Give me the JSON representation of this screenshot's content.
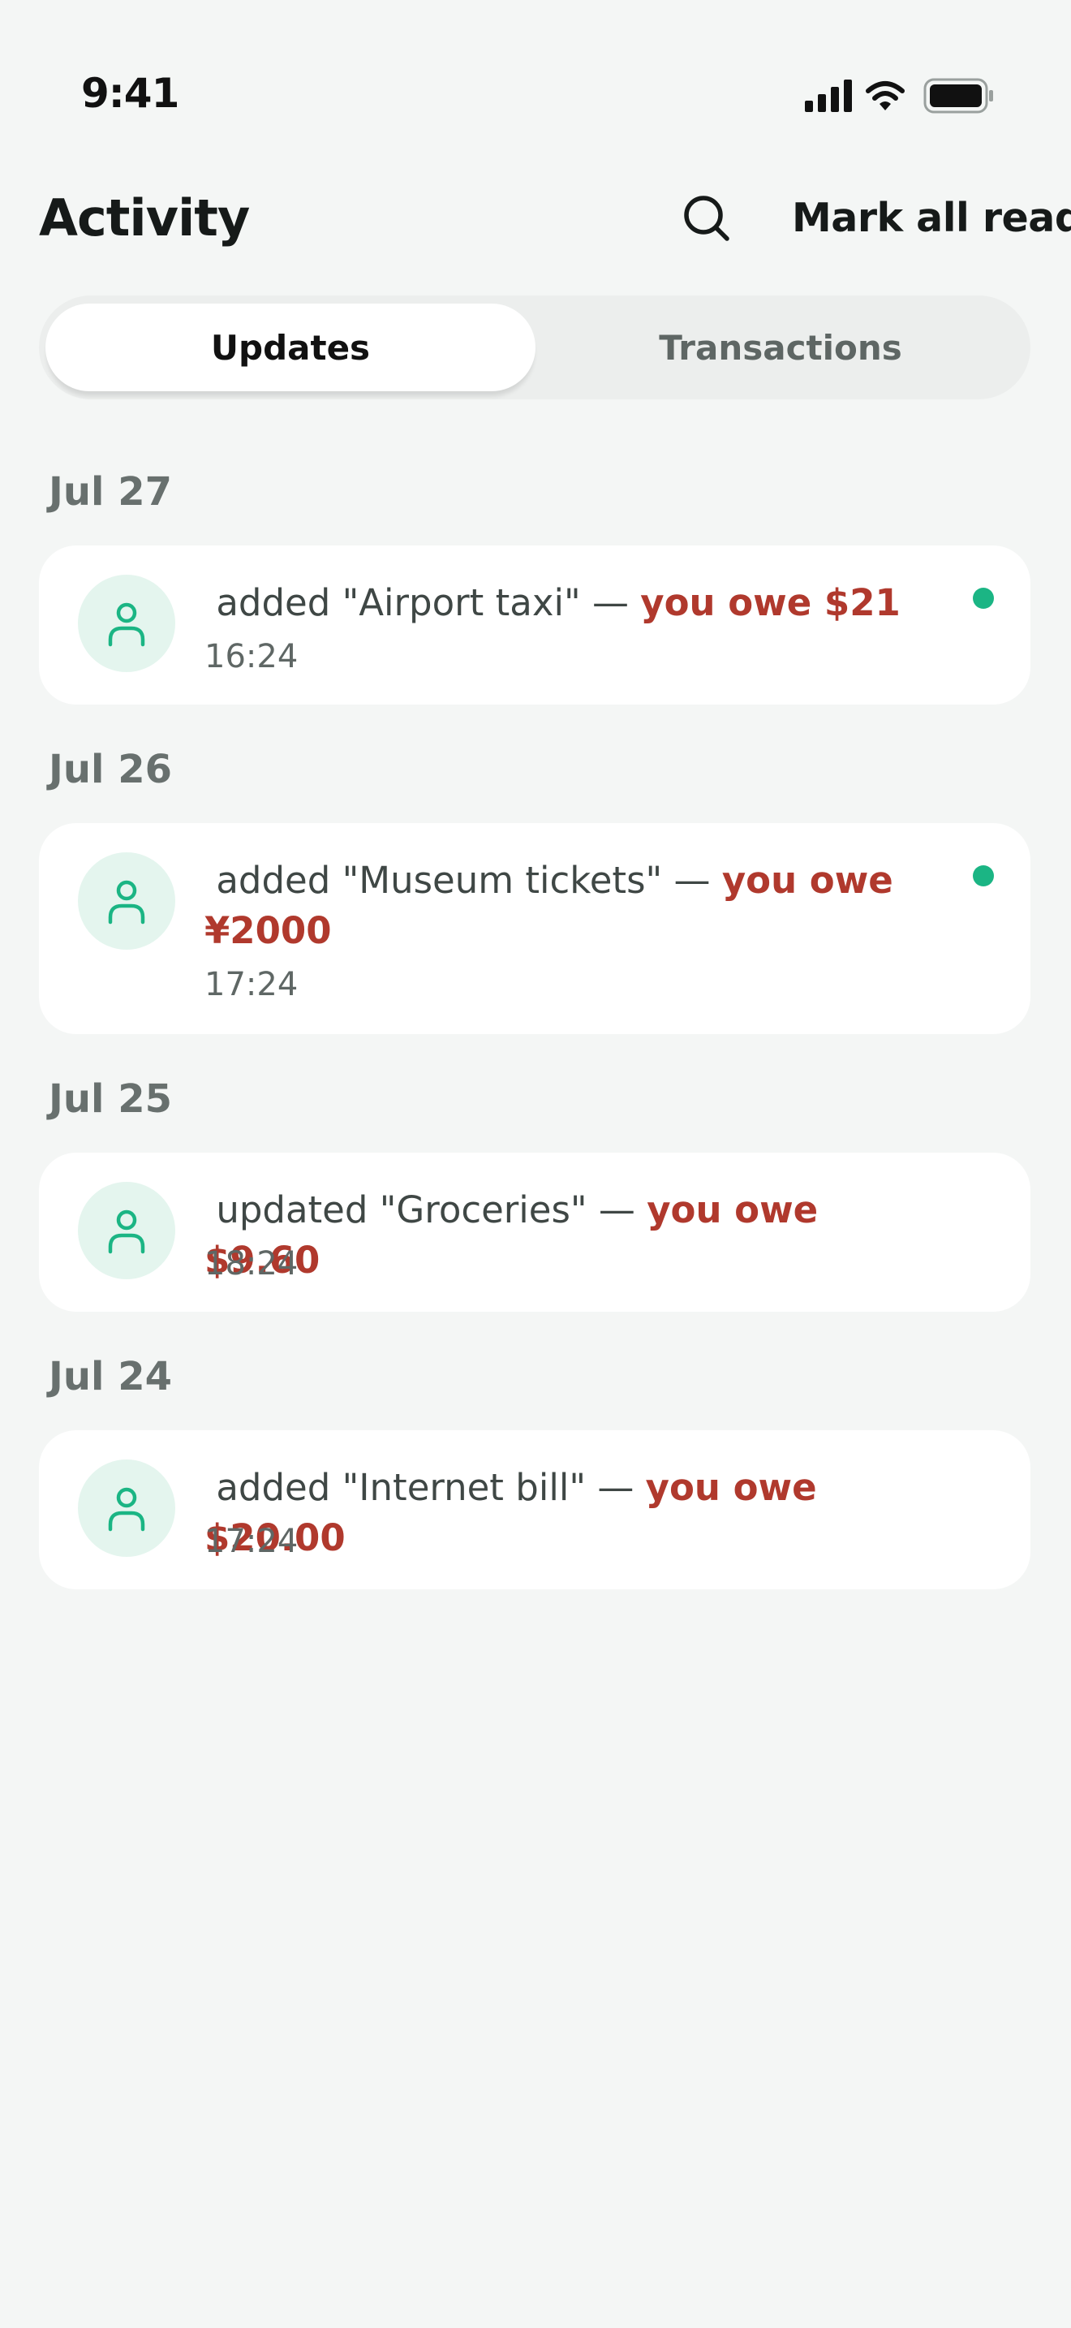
{
  "status_bar": {
    "time": "9:41"
  },
  "header": {
    "title": "Activity",
    "mark_all_read": "Mark all read"
  },
  "tabs": [
    {
      "label": "Updates",
      "active": true
    },
    {
      "label": "Transactions",
      "active": false
    }
  ],
  "groups": [
    {
      "date": "Jul 27",
      "item": {
        "description": " added \"Airport taxi\" — ",
        "amount": "you owe $21",
        "time": "16:24",
        "unread": true
      }
    },
    {
      "date": "Jul 26",
      "item": {
        "description": " added \"Museum tickets\" — ",
        "amount": "you owe ¥2000",
        "time": "17:24",
        "unread": true
      }
    },
    {
      "date": "Jul 25",
      "item": {
        "description": " updated \"Groceries\" — ",
        "amount": "you owe $9.60",
        "time": "18:24",
        "unread": false
      }
    },
    {
      "date": "Jul 24",
      "item": {
        "description": " added \"Internet bill\" — ",
        "amount": "you owe $20.00",
        "time": "17:24",
        "unread": false
      }
    }
  ],
  "icons": {
    "search": "search-icon",
    "avatar": "person-icon",
    "signal": "cellular-signal-icon",
    "wifi": "wifi-icon",
    "battery": "battery-icon"
  },
  "colors": {
    "accent_green": "#1bb584",
    "owe_red": "#b0392d",
    "background": "#f4f6f5",
    "avatar_bg": "#e4f5ee"
  }
}
